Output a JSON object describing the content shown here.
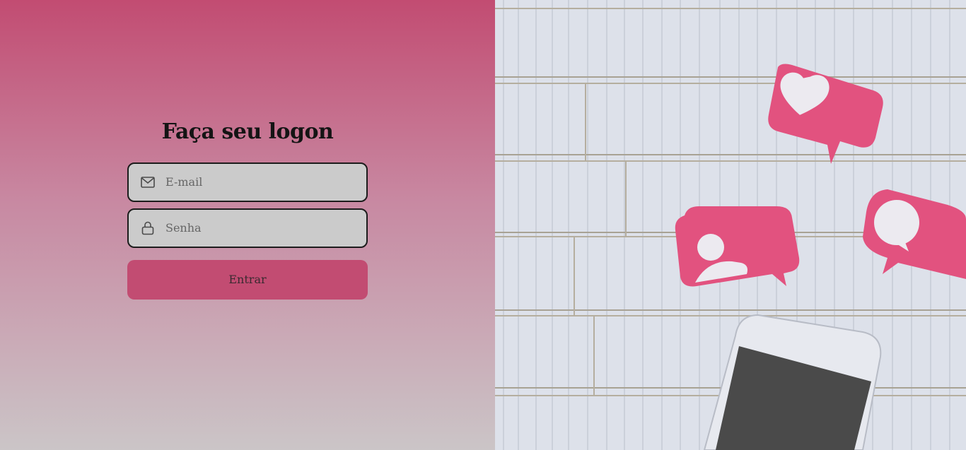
{
  "login": {
    "title": "Faça seu logon",
    "email_placeholder": "E-mail",
    "password_placeholder": "Senha",
    "submit_label": "Entrar"
  },
  "colors": {
    "brand": "#c24c72",
    "gradient_bottom": "#cbc5c7",
    "input_bg": "#cbcbcb",
    "bubble_pink": "#e2527f"
  },
  "icons": {
    "email": "mail-icon",
    "password": "lock-icon"
  }
}
